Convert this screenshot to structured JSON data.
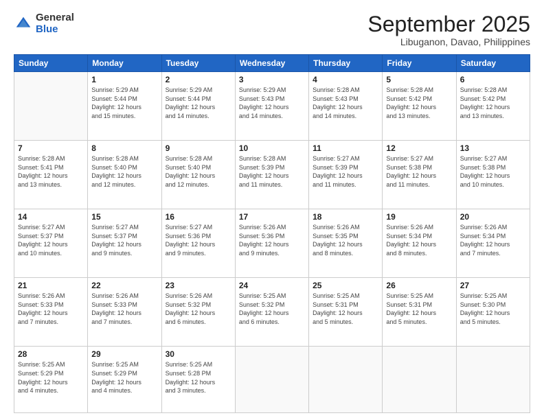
{
  "logo": {
    "general": "General",
    "blue": "Blue"
  },
  "header": {
    "month_year": "September 2025",
    "location": "Libuganon, Davao, Philippines"
  },
  "weekdays": [
    "Sunday",
    "Monday",
    "Tuesday",
    "Wednesday",
    "Thursday",
    "Friday",
    "Saturday"
  ],
  "weeks": [
    [
      {
        "day": "",
        "info": ""
      },
      {
        "day": "1",
        "info": "Sunrise: 5:29 AM\nSunset: 5:44 PM\nDaylight: 12 hours\nand 15 minutes."
      },
      {
        "day": "2",
        "info": "Sunrise: 5:29 AM\nSunset: 5:44 PM\nDaylight: 12 hours\nand 14 minutes."
      },
      {
        "day": "3",
        "info": "Sunrise: 5:29 AM\nSunset: 5:43 PM\nDaylight: 12 hours\nand 14 minutes."
      },
      {
        "day": "4",
        "info": "Sunrise: 5:28 AM\nSunset: 5:43 PM\nDaylight: 12 hours\nand 14 minutes."
      },
      {
        "day": "5",
        "info": "Sunrise: 5:28 AM\nSunset: 5:42 PM\nDaylight: 12 hours\nand 13 minutes."
      },
      {
        "day": "6",
        "info": "Sunrise: 5:28 AM\nSunset: 5:42 PM\nDaylight: 12 hours\nand 13 minutes."
      }
    ],
    [
      {
        "day": "7",
        "info": "Sunrise: 5:28 AM\nSunset: 5:41 PM\nDaylight: 12 hours\nand 13 minutes."
      },
      {
        "day": "8",
        "info": "Sunrise: 5:28 AM\nSunset: 5:40 PM\nDaylight: 12 hours\nand 12 minutes."
      },
      {
        "day": "9",
        "info": "Sunrise: 5:28 AM\nSunset: 5:40 PM\nDaylight: 12 hours\nand 12 minutes."
      },
      {
        "day": "10",
        "info": "Sunrise: 5:28 AM\nSunset: 5:39 PM\nDaylight: 12 hours\nand 11 minutes."
      },
      {
        "day": "11",
        "info": "Sunrise: 5:27 AM\nSunset: 5:39 PM\nDaylight: 12 hours\nand 11 minutes."
      },
      {
        "day": "12",
        "info": "Sunrise: 5:27 AM\nSunset: 5:38 PM\nDaylight: 12 hours\nand 11 minutes."
      },
      {
        "day": "13",
        "info": "Sunrise: 5:27 AM\nSunset: 5:38 PM\nDaylight: 12 hours\nand 10 minutes."
      }
    ],
    [
      {
        "day": "14",
        "info": "Sunrise: 5:27 AM\nSunset: 5:37 PM\nDaylight: 12 hours\nand 10 minutes."
      },
      {
        "day": "15",
        "info": "Sunrise: 5:27 AM\nSunset: 5:37 PM\nDaylight: 12 hours\nand 9 minutes."
      },
      {
        "day": "16",
        "info": "Sunrise: 5:27 AM\nSunset: 5:36 PM\nDaylight: 12 hours\nand 9 minutes."
      },
      {
        "day": "17",
        "info": "Sunrise: 5:26 AM\nSunset: 5:36 PM\nDaylight: 12 hours\nand 9 minutes."
      },
      {
        "day": "18",
        "info": "Sunrise: 5:26 AM\nSunset: 5:35 PM\nDaylight: 12 hours\nand 8 minutes."
      },
      {
        "day": "19",
        "info": "Sunrise: 5:26 AM\nSunset: 5:34 PM\nDaylight: 12 hours\nand 8 minutes."
      },
      {
        "day": "20",
        "info": "Sunrise: 5:26 AM\nSunset: 5:34 PM\nDaylight: 12 hours\nand 7 minutes."
      }
    ],
    [
      {
        "day": "21",
        "info": "Sunrise: 5:26 AM\nSunset: 5:33 PM\nDaylight: 12 hours\nand 7 minutes."
      },
      {
        "day": "22",
        "info": "Sunrise: 5:26 AM\nSunset: 5:33 PM\nDaylight: 12 hours\nand 7 minutes."
      },
      {
        "day": "23",
        "info": "Sunrise: 5:26 AM\nSunset: 5:32 PM\nDaylight: 12 hours\nand 6 minutes."
      },
      {
        "day": "24",
        "info": "Sunrise: 5:25 AM\nSunset: 5:32 PM\nDaylight: 12 hours\nand 6 minutes."
      },
      {
        "day": "25",
        "info": "Sunrise: 5:25 AM\nSunset: 5:31 PM\nDaylight: 12 hours\nand 5 minutes."
      },
      {
        "day": "26",
        "info": "Sunrise: 5:25 AM\nSunset: 5:31 PM\nDaylight: 12 hours\nand 5 minutes."
      },
      {
        "day": "27",
        "info": "Sunrise: 5:25 AM\nSunset: 5:30 PM\nDaylight: 12 hours\nand 5 minutes."
      }
    ],
    [
      {
        "day": "28",
        "info": "Sunrise: 5:25 AM\nSunset: 5:29 PM\nDaylight: 12 hours\nand 4 minutes."
      },
      {
        "day": "29",
        "info": "Sunrise: 5:25 AM\nSunset: 5:29 PM\nDaylight: 12 hours\nand 4 minutes."
      },
      {
        "day": "30",
        "info": "Sunrise: 5:25 AM\nSunset: 5:28 PM\nDaylight: 12 hours\nand 3 minutes."
      },
      {
        "day": "",
        "info": ""
      },
      {
        "day": "",
        "info": ""
      },
      {
        "day": "",
        "info": ""
      },
      {
        "day": "",
        "info": ""
      }
    ]
  ]
}
